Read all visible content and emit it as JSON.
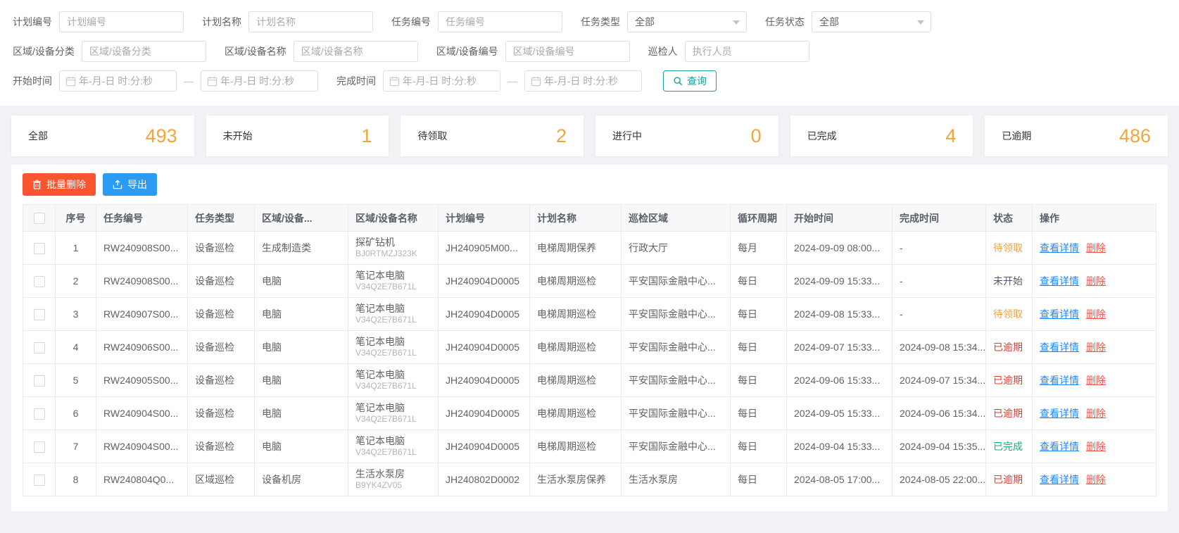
{
  "colors": {
    "accent_orange": "#f2a53c",
    "btn_delete_bg": "#fb5430",
    "btn_export_bg": "#2b9bf4",
    "search_teal": "#18a29a",
    "link_view": "#2189f3",
    "link_delete": "#f0564a",
    "status_pending": "#eda240",
    "status_not_started": "#515a6e",
    "status_overdue": "#e23b30",
    "status_done": "#0ab57c"
  },
  "filters": {
    "fields_row1": [
      {
        "label": "计划编号",
        "placeholder": "计划编号"
      },
      {
        "label": "计划名称",
        "placeholder": "计划名称"
      },
      {
        "label": "任务编号",
        "placeholder": "任务编号"
      },
      {
        "label": "任务类型",
        "value": "全部"
      },
      {
        "label": "任务状态",
        "value": "全部"
      }
    ],
    "fields_row2": [
      {
        "label": "区域/设备分类",
        "placeholder": "区域/设备分类"
      },
      {
        "label": "区域/设备名称",
        "placeholder": "区域/设备名称"
      },
      {
        "label": "区域/设备编号",
        "placeholder": "区域/设备编号"
      },
      {
        "label": "巡检人",
        "placeholder": "执行人员"
      }
    ],
    "time_row": {
      "start_label": "开始时间",
      "finish_label": "完成时间",
      "date_placeholder": "年-月-日 时:分:秒",
      "range_separator": "—",
      "search_label": "查询"
    }
  },
  "stats": [
    {
      "label": "全部",
      "value": "493"
    },
    {
      "label": "未开始",
      "value": "1"
    },
    {
      "label": "待领取",
      "value": "2"
    },
    {
      "label": "进行中",
      "value": "0"
    },
    {
      "label": "已完成",
      "value": "4"
    },
    {
      "label": "已逾期",
      "value": "486"
    }
  ],
  "toolbar": {
    "batch_delete": "批量删除",
    "export": "导出"
  },
  "table": {
    "columns": [
      "序号",
      "任务编号",
      "任务类型",
      "区域/设备...",
      "区域/设备名称",
      "计划编号",
      "计划名称",
      "巡检区域",
      "循环周期",
      "开始时间",
      "完成时间",
      "状态",
      "操作"
    ],
    "actions": {
      "view": "查看详情",
      "delete": "删除"
    },
    "rows": [
      {
        "index": "1",
        "task_no": "RW240908S00...",
        "task_type": "设备巡检",
        "device_category": "生成制造类",
        "device_name": "探矿钻机",
        "device_code": "BJ0RTMZJ323K",
        "plan_no": "JH240905M00...",
        "plan_name": "电梯周期保养",
        "area": "行政大厅",
        "cycle": "每月",
        "start_time": "2024-09-09 08:00...",
        "finish_time": "-",
        "status": "待领取",
        "status_type": "pending"
      },
      {
        "index": "2",
        "task_no": "RW240908S00...",
        "task_type": "设备巡检",
        "device_category": "电脑",
        "device_name": "笔记本电脑",
        "device_code": "V34Q2E7B671L",
        "plan_no": "JH240904D0005",
        "plan_name": "电梯周期巡检",
        "area": "平安国际金融中心...",
        "cycle": "每日",
        "start_time": "2024-09-09 15:33...",
        "finish_time": "-",
        "status": "未开始",
        "status_type": "not_started"
      },
      {
        "index": "3",
        "task_no": "RW240907S00...",
        "task_type": "设备巡检",
        "device_category": "电脑",
        "device_name": "笔记本电脑",
        "device_code": "V34Q2E7B671L",
        "plan_no": "JH240904D0005",
        "plan_name": "电梯周期巡检",
        "area": "平安国际金融中心...",
        "cycle": "每日",
        "start_time": "2024-09-08 15:33...",
        "finish_time": "-",
        "status": "待领取",
        "status_type": "pending"
      },
      {
        "index": "4",
        "task_no": "RW240906S00...",
        "task_type": "设备巡检",
        "device_category": "电脑",
        "device_name": "笔记本电脑",
        "device_code": "V34Q2E7B671L",
        "plan_no": "JH240904D0005",
        "plan_name": "电梯周期巡检",
        "area": "平安国际金融中心...",
        "cycle": "每日",
        "start_time": "2024-09-07 15:33...",
        "finish_time": "2024-09-08 15:34...",
        "status": "已逾期",
        "status_type": "overdue"
      },
      {
        "index": "5",
        "task_no": "RW240905S00...",
        "task_type": "设备巡检",
        "device_category": "电脑",
        "device_name": "笔记本电脑",
        "device_code": "V34Q2E7B671L",
        "plan_no": "JH240904D0005",
        "plan_name": "电梯周期巡检",
        "area": "平安国际金融中心...",
        "cycle": "每日",
        "start_time": "2024-09-06 15:33...",
        "finish_time": "2024-09-07 15:34...",
        "status": "已逾期",
        "status_type": "overdue"
      },
      {
        "index": "6",
        "task_no": "RW240904S00...",
        "task_type": "设备巡检",
        "device_category": "电脑",
        "device_name": "笔记本电脑",
        "device_code": "V34Q2E7B671L",
        "plan_no": "JH240904D0005",
        "plan_name": "电梯周期巡检",
        "area": "平安国际金融中心...",
        "cycle": "每日",
        "start_time": "2024-09-05 15:33...",
        "finish_time": "2024-09-06 15:34...",
        "status": "已逾期",
        "status_type": "overdue"
      },
      {
        "index": "7",
        "task_no": "RW240904S00...",
        "task_type": "设备巡检",
        "device_category": "电脑",
        "device_name": "笔记本电脑",
        "device_code": "V34Q2E7B671L",
        "plan_no": "JH240904D0005",
        "plan_name": "电梯周期巡检",
        "area": "平安国际金融中心...",
        "cycle": "每日",
        "start_time": "2024-09-04 15:33...",
        "finish_time": "2024-09-04 15:35...",
        "status": "已完成",
        "status_type": "done"
      },
      {
        "index": "8",
        "task_no": "RW240804Q0...",
        "task_type": "区域巡检",
        "device_category": "设备机房",
        "device_name": "生活水泵房",
        "device_code": "B9YK4ZV05",
        "plan_no": "JH240802D0002",
        "plan_name": "生活水泵房保养",
        "area": "生活水泵房",
        "cycle": "每日",
        "start_time": "2024-08-05 17:00...",
        "finish_time": "2024-08-05 22:00...",
        "status": "已逾期",
        "status_type": "overdue"
      }
    ]
  }
}
